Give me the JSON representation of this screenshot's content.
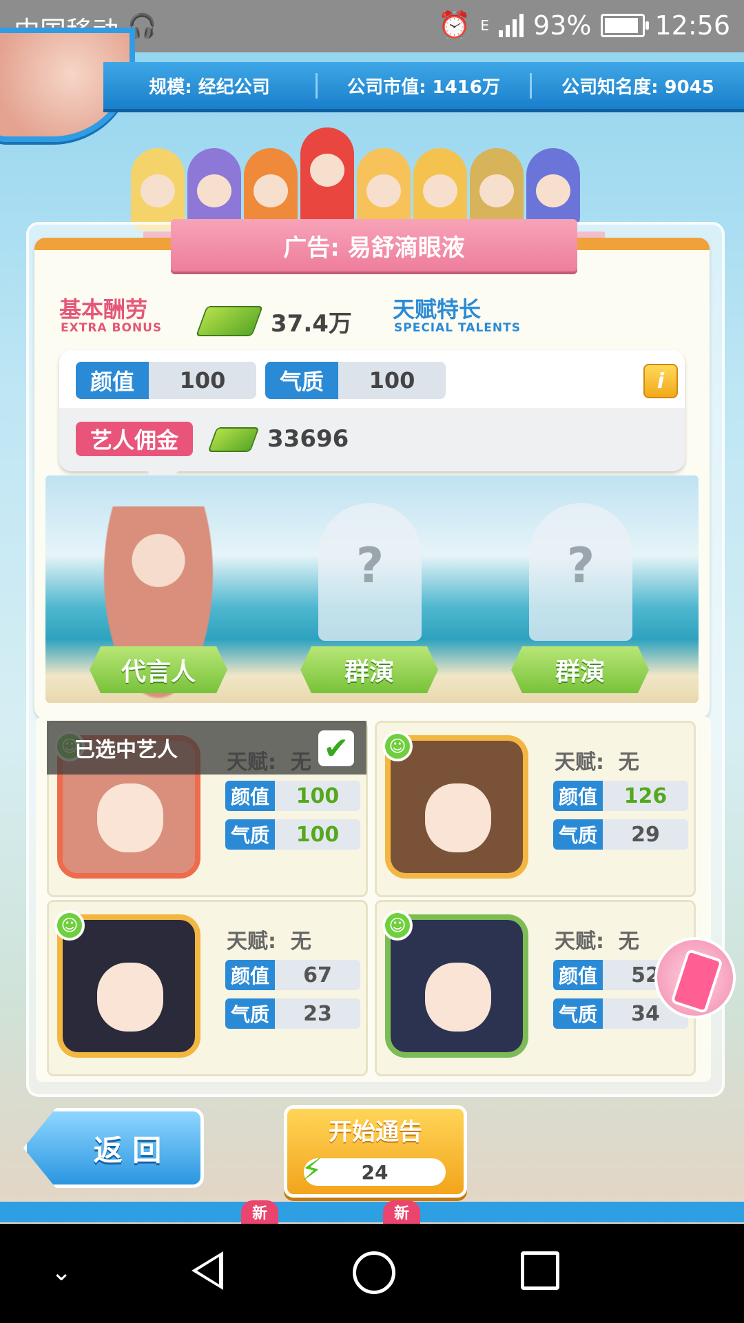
{
  "status_bar": {
    "carrier": "中国移动",
    "battery_percent": "93%",
    "battery_level": 0.93,
    "time": "12:56",
    "network": "E"
  },
  "top_bar": {
    "scale": "规模: 经纪公司",
    "market_value": "公司市值: 1416万",
    "fame": "公司知名度: 9045"
  },
  "ad": {
    "title": "广告: 易舒滴眼液"
  },
  "bonus": {
    "label": "基本酬劳",
    "label_en": "EXTRA   BONUS",
    "value": "37.4万"
  },
  "talents": {
    "label": "天赋特长",
    "label_en": "SPECIAL   TALENTS"
  },
  "requirements": {
    "looks_label": "颜值",
    "looks_value": "100",
    "temperament_label": "气质",
    "temperament_value": "100",
    "commission_label": "艺人佣金",
    "commission_value": "33696"
  },
  "roles": [
    {
      "label": "代言人",
      "placeholder": ""
    },
    {
      "label": "群演",
      "placeholder": "?"
    },
    {
      "label": "群演",
      "placeholder": "?"
    }
  ],
  "roster": {
    "selected_label": "已选中艺人",
    "talent_label": "天赋:",
    "stat_looks": "颜值",
    "stat_temperament": "气质",
    "artists": [
      {
        "talent": "无",
        "looks": "100",
        "temperament": "100",
        "selected": true
      },
      {
        "talent": "无",
        "looks": "126",
        "temperament": "29",
        "selected": false
      },
      {
        "talent": "无",
        "looks": "67",
        "temperament": "23",
        "selected": false
      },
      {
        "talent": "无",
        "looks": "52",
        "temperament": "34",
        "selected": false
      }
    ]
  },
  "buttons": {
    "back": "返 回",
    "start": "开始通告",
    "energy": "24"
  },
  "bottom_badges": [
    "新",
    "新"
  ],
  "colors": {
    "accent_blue": "#2a8ad6",
    "pink": "#e9557a",
    "green": "#78c23a",
    "orange": "#f3a41c"
  }
}
